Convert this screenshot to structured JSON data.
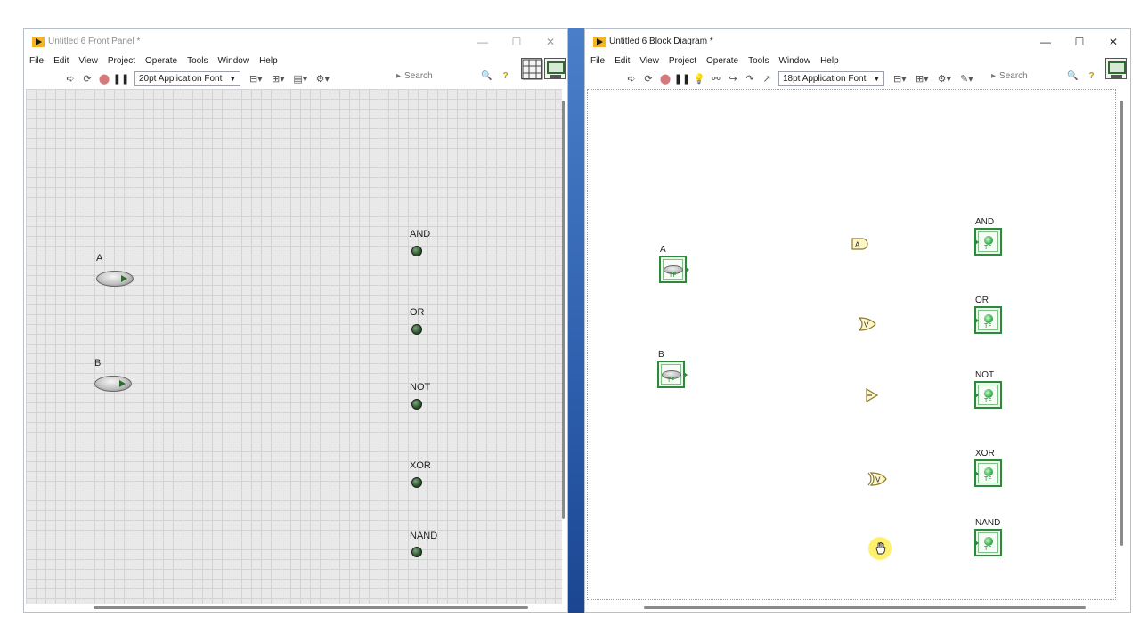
{
  "front_panel": {
    "title": "Untitled 6 Front Panel *",
    "menu": [
      "File",
      "Edit",
      "View",
      "Project",
      "Operate",
      "Tools",
      "Window",
      "Help"
    ],
    "font_selector": "20pt Application Font",
    "search_placeholder": "Search",
    "controls": [
      {
        "label": "A"
      },
      {
        "label": "B"
      }
    ],
    "indicators": [
      {
        "label": "AND"
      },
      {
        "label": "OR"
      },
      {
        "label": "NOT"
      },
      {
        "label": "XOR"
      },
      {
        "label": "NAND"
      }
    ]
  },
  "block_diagram": {
    "title": "Untitled 6 Block Diagram *",
    "menu": [
      "File",
      "Edit",
      "View",
      "Project",
      "Operate",
      "Tools",
      "Window",
      "Help"
    ],
    "font_selector": "18pt Application Font",
    "search_placeholder": "Search",
    "control_terminals": [
      {
        "label": "A"
      },
      {
        "label": "B"
      }
    ],
    "indicator_terminals": [
      {
        "label": "AND"
      },
      {
        "label": "OR"
      },
      {
        "label": "NOT"
      },
      {
        "label": "XOR"
      },
      {
        "label": "NAND"
      }
    ],
    "gates": [
      "and-gate",
      "or-gate",
      "not-gate",
      "xor-gate",
      "nand-gate"
    ],
    "terminal_caption": "TF"
  },
  "colors": {
    "terminal_border": "#2c8a3a",
    "led_off": "#2e5a2e",
    "cursor_highlight": "#ffec3c"
  }
}
